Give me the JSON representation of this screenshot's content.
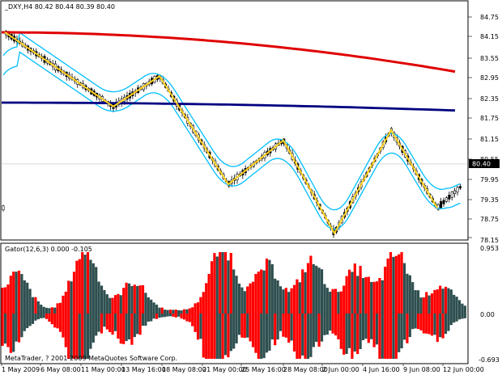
{
  "main_panel": {
    "header": "_DXY,H4  80.42 80.44 80.39 80.40",
    "price_scale": [
      "84.75",
      "84.15",
      "83.55",
      "82.95",
      "82.35",
      "81.75",
      "81.15",
      "80.55",
      "79.95",
      "79.35",
      "78.75",
      "78.15"
    ],
    "current_price": "80.40"
  },
  "indicator_panel": {
    "header": "Gator(12,6,3) 0.000 -0.105",
    "scale": [
      "0.953",
      "0.00",
      "-0.693"
    ],
    "copyright": "MetaTrader, ? 2001-2009 MetaQuotes Software Corp."
  },
  "time_axis": [
    "1 May 2009",
    "6 May 08:00",
    "11 May 00:00",
    "13 May 16:00",
    "18 May 08:00",
    "21 May 00:00",
    "25 May 16:00",
    "28 May 08:00",
    "2 Jun 00:00",
    "4 Jun 16:00",
    "9 Jun 08:00",
    "12 Jun 00:00"
  ],
  "colors": {
    "bull_candle": "#ffffff",
    "bear_candle": "#000000",
    "envelope": "#00bfff",
    "zigzag": "#ffd21f",
    "slow_ma": "#e00000",
    "mid_ma": "#000080",
    "gator_up": "#ff0000",
    "gator_down": "#2f4f4f"
  },
  "chart_data": {
    "type": "candlestick",
    "price_levels": {
      "min": 78.15,
      "max": 84.75,
      "current": 80.4
    },
    "zigzag_points": [
      {
        "t": "1 May 2009",
        "price": 84.3
      },
      {
        "t": "11 May 00:00",
        "price": 82.1
      },
      {
        "t": "13 May 16:00",
        "price": 83.0
      },
      {
        "t": "21 May 00:00",
        "price": 79.8
      },
      {
        "t": "28 May 08:00",
        "price": 81.1
      },
      {
        "t": "2 Jun 00:00",
        "price": 78.35
      },
      {
        "t": "4 Jun 16:00",
        "price": 81.4
      },
      {
        "t": "12 Jun 00:00",
        "price": 79.1
      }
    ]
  }
}
